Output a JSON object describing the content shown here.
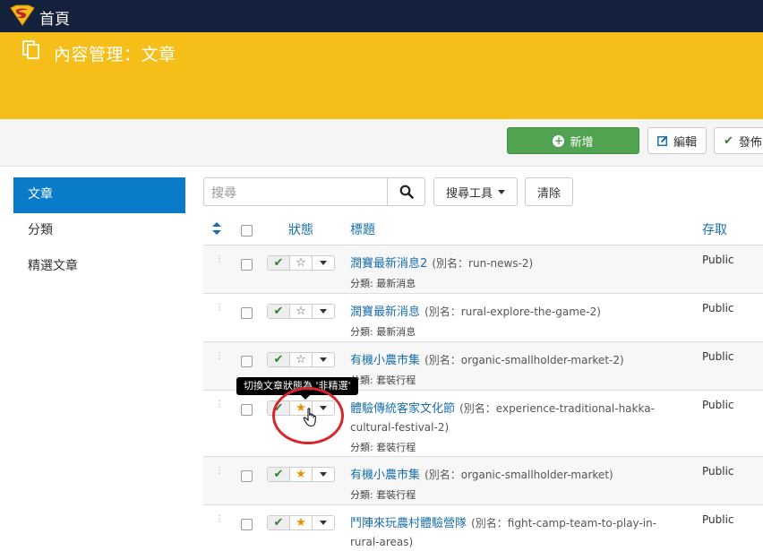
{
  "topbar": {
    "home_label": "首頁"
  },
  "banner": {
    "title": "內容管理：文章"
  },
  "toolbar": {
    "new_label": "新增",
    "edit_label": "編輯",
    "publish_label": "發佈"
  },
  "sidebar": {
    "items": [
      {
        "label": "文章",
        "active": true
      },
      {
        "label": "分類",
        "active": false
      },
      {
        "label": "精選文章",
        "active": false
      }
    ]
  },
  "search": {
    "placeholder": "搜尋",
    "tools_label": "搜尋工具",
    "clear_label": "清除"
  },
  "table": {
    "headers": {
      "status": "狀態",
      "title": "標題",
      "access": "存取"
    },
    "rows": [
      {
        "title": "潤寶最新消息2",
        "alias": "(別名：run-news-2)",
        "category": "分類: 最新消息",
        "access": "Public",
        "featured": false
      },
      {
        "title": "潤寶最新消息",
        "alias": "(別名：rural-explore-the-game-2)",
        "category": "分類: 最新消息",
        "access": "Public",
        "featured": false
      },
      {
        "title": "有機小農市集",
        "alias": "(別名：organic-smallholder-market-2)",
        "category": "分類: 套裝行程",
        "access": "Public",
        "featured": false
      },
      {
        "title": "體驗傳統客家文化節",
        "alias": "(別名：experience-traditional-hakka-cultural-festival-2)",
        "category": "分類: 套裝行程",
        "access": "Public",
        "featured": true
      },
      {
        "title": "有機小農市集",
        "alias": "(別名：organic-smallholder-market)",
        "category": "分類: 套裝行程",
        "access": "Public",
        "featured": true
      },
      {
        "title": "鬥陣來玩農村體驗營隊",
        "alias": "(別名：fight-camp-team-to-play-in-rural-areas)",
        "category": "",
        "access": "Public",
        "featured": true
      }
    ]
  },
  "tooltip": {
    "text": "切換文章狀態為 '非精選'"
  },
  "colors": {
    "topbar": "#13213c",
    "banner": "#f6be19",
    "accent": "#0a7bc9",
    "success": "#51a351",
    "link": "#1a6fab",
    "star_on": "#f08c00"
  }
}
